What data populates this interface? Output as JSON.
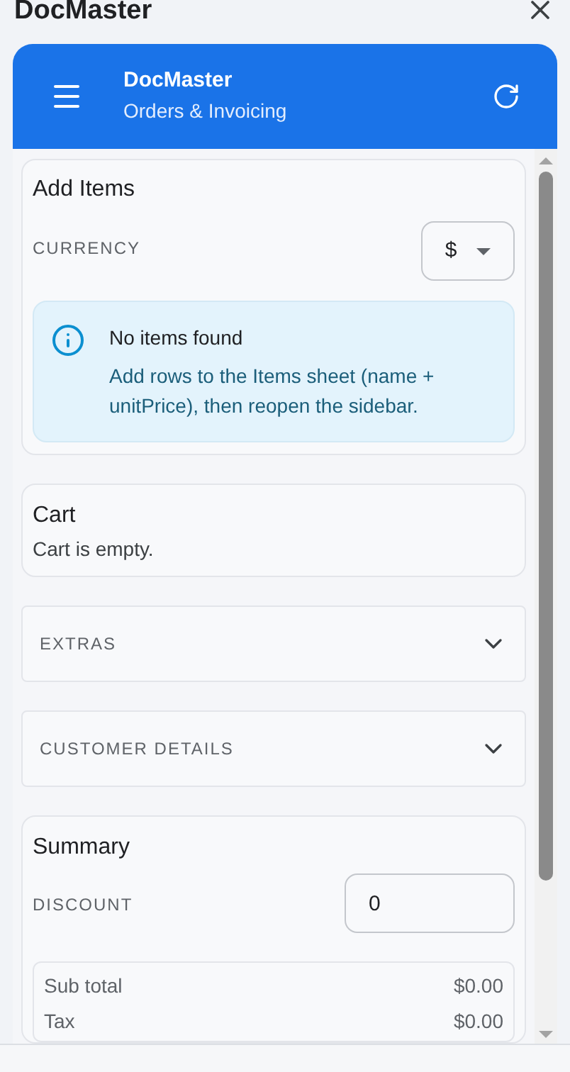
{
  "window": {
    "title": "DocMaster"
  },
  "header": {
    "title": "DocMaster",
    "subtitle": "Orders & Invoicing"
  },
  "add_items": {
    "title": "Add Items",
    "currency_label": "CURRENCY",
    "currency_value": "$",
    "notice": {
      "title": "No items found",
      "body": "Add rows to the Items sheet (name + unitPrice), then reopen the sidebar."
    }
  },
  "cart": {
    "title": "Cart",
    "empty_text": "Cart is empty."
  },
  "sections": [
    {
      "label": "EXTRAS",
      "expanded": false
    },
    {
      "label": "CUSTOMER DETAILS",
      "expanded": false
    }
  ],
  "summary": {
    "title": "Summary",
    "discount_label": "DISCOUNT",
    "discount_value": "0",
    "rows": [
      {
        "label": "Sub total",
        "value": "$0.00"
      },
      {
        "label": "Tax",
        "value": "$0.00"
      }
    ]
  }
}
